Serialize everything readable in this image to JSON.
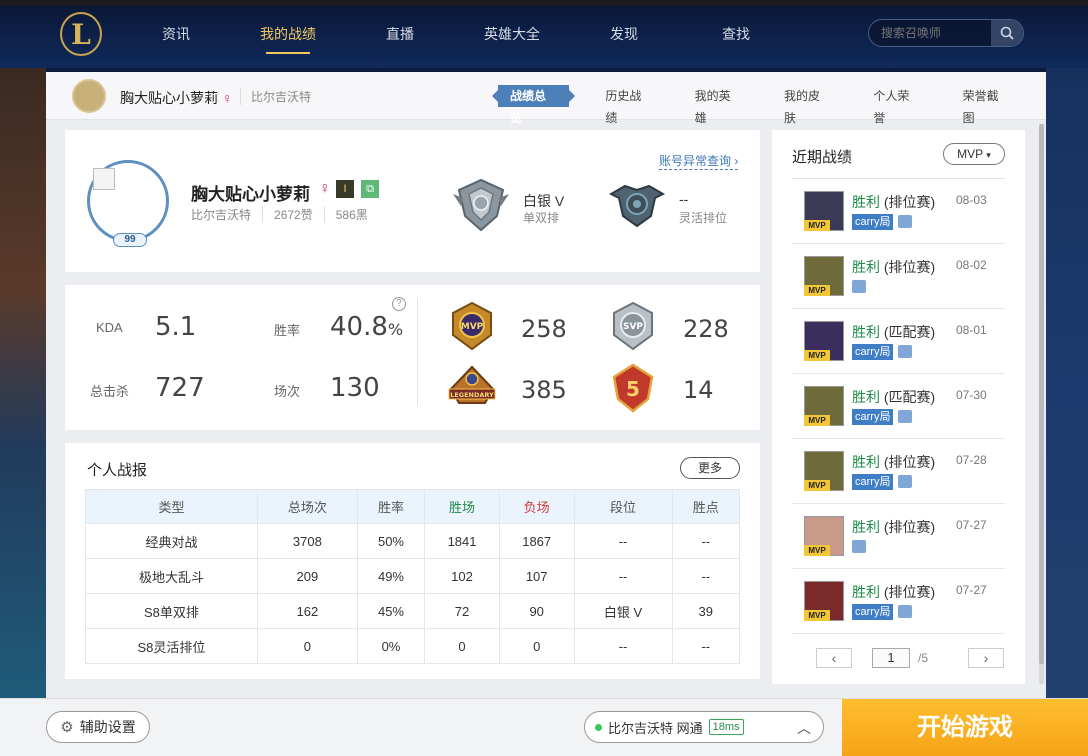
{
  "nav": {
    "logo_text": "L",
    "items": [
      "资讯",
      "我的战绩",
      "直播",
      "英雄大全",
      "发现",
      "查找"
    ],
    "active": "我的战绩",
    "search_placeholder": "搜索召唤师"
  },
  "subbar": {
    "name": "胸大贴心小萝莉",
    "gender": "♀",
    "server": "比尔吉沃特",
    "tabs": [
      "战绩总览",
      "历史战绩",
      "我的英雄",
      "我的皮肤",
      "个人荣誉",
      "荣誉截图"
    ],
    "active_tab": "战绩总览"
  },
  "profile": {
    "name": "胸大贴心小萝莉",
    "gender": "♀",
    "level": "99",
    "server": "比尔吉沃特",
    "likes": "2672赞",
    "blacks": "586黑",
    "anomaly_link": "账号异常查询 ›",
    "solo_rank": "白银 V",
    "solo_label": "单双排",
    "flex_rank": "--",
    "flex_label": "灵活排位"
  },
  "stats": {
    "kda_label": "KDA",
    "kda": "5.1",
    "winrate_label": "胜率",
    "winrate": "40.8",
    "winrate_unit": "%",
    "kills_label": "总击杀",
    "kills": "727",
    "games_label": "场次",
    "games": "130",
    "help": "?",
    "honors": [
      {
        "name": "mvp",
        "count": "258"
      },
      {
        "name": "svp",
        "count": "228"
      },
      {
        "name": "legendary",
        "count": "385"
      },
      {
        "name": "penta",
        "count": "14"
      }
    ]
  },
  "report": {
    "title": "个人战报",
    "more": "更多",
    "headers": [
      "类型",
      "总场次",
      "胜率",
      "胜场",
      "负场",
      "段位",
      "胜点"
    ],
    "rows": [
      [
        "经典对战",
        "3708",
        "50%",
        "1841",
        "1867",
        "--",
        "--"
      ],
      [
        "极地大乱斗",
        "209",
        "49%",
        "102",
        "107",
        "--",
        "--"
      ],
      [
        "S8单双排",
        "162",
        "45%",
        "72",
        "90",
        "白银 V",
        "39"
      ],
      [
        "S8灵活排位",
        "0",
        "0%",
        "0",
        "0",
        "--",
        "--"
      ]
    ]
  },
  "recent": {
    "title": "近期战绩",
    "filter": "MVP",
    "matches": [
      {
        "result": "胜利",
        "mode": "(排位赛)",
        "date": "08-03",
        "carry": true,
        "color": "#3b3a55"
      },
      {
        "result": "胜利",
        "mode": "(排位赛)",
        "date": "08-02",
        "carry": false,
        "color": "#6e6a3a"
      },
      {
        "result": "胜利",
        "mode": "(匹配赛)",
        "date": "08-01",
        "carry": true,
        "color": "#3a2f5c"
      },
      {
        "result": "胜利",
        "mode": "(匹配赛)",
        "date": "07-30",
        "carry": true,
        "color": "#6e6a3a"
      },
      {
        "result": "胜利",
        "mode": "(排位赛)",
        "date": "07-28",
        "carry": true,
        "color": "#6e6a3a"
      },
      {
        "result": "胜利",
        "mode": "(排位赛)",
        "date": "07-27",
        "carry": false,
        "color": "#c79a8a"
      },
      {
        "result": "胜利",
        "mode": "(排位赛)",
        "date": "07-27",
        "carry": true,
        "color": "#7a2a2a"
      }
    ],
    "carry_label": "carry局",
    "mvp_tag": "MVP",
    "page_current": "1",
    "page_total": "/5",
    "prev": "‹",
    "next": "›"
  },
  "bottom": {
    "assist": "辅助设置",
    "server": "比尔吉沃特 网通",
    "ping": "18ms",
    "start": "开始游戏"
  },
  "colors": {
    "accent_blue": "#4d7fb8",
    "win_green": "#1e8a48",
    "loss_red": "#d03a3a",
    "start_orange": "#f5a316",
    "nav_gold": "#f0c860"
  }
}
